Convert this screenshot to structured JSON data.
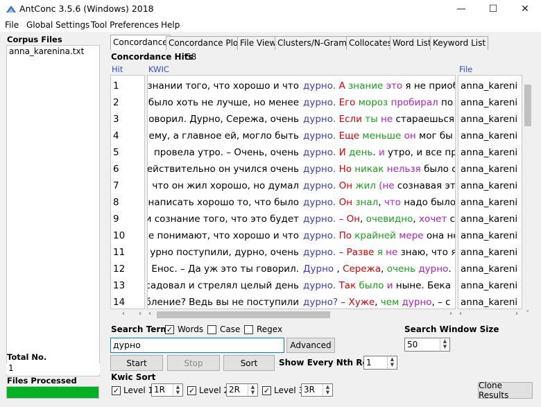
{
  "window": {
    "title": "AntConc 3.5.6 (Windows) 2018"
  },
  "menu": [
    "File",
    "Global Settings",
    "Tool Preferences",
    "Help"
  ],
  "sidebar": {
    "corpus_files_label": "Corpus Files",
    "files": [
      "anna_karenina.txt"
    ],
    "total_no_label": "Total No.",
    "total_no_value": "1",
    "files_processed_label": "Files Processed",
    "progress": 1.0
  },
  "tabs": [
    "Concordance",
    "Concordance Plot",
    "File View",
    "Clusters/N-Grams",
    "Collocates",
    "Word List",
    "Keyword List"
  ],
  "concordance": {
    "hits_label": "Concordance Hits",
    "hits_value": "58",
    "col_hit": "Hit",
    "col_kwic": "KWIC",
    "col_file": "File",
    "rows": [
      {
        "hit": "1",
        "left": "знании того, что хорошо и что",
        "kw": "дурно.",
        "right": [
          [
            "А",
            "red"
          ],
          [
            " знание ",
            "green"
          ],
          [
            "это",
            "pur"
          ],
          [
            " я не приоб",
            "black"
          ]
        ],
        "file": "anna_kareni"
      },
      {
        "hit": "2",
        "left": "было хоть не лучше, но менее",
        "kw": "дурно.",
        "right": [
          [
            "Его ",
            "red"
          ],
          [
            "мороз ",
            "green"
          ],
          [
            "пробирал",
            "pur"
          ],
          [
            " по",
            "black"
          ]
        ],
        "file": "anna_kareni"
      },
      {
        "hit": "3",
        "left": "оворил. Дурно, Сережа, очень",
        "kw": "дурно.",
        "right": [
          [
            "Если ",
            "red"
          ],
          [
            "ты ",
            "green"
          ],
          [
            "не ",
            "pur"
          ],
          [
            "стараешься у",
            "black"
          ]
        ],
        "file": "anna_kareni"
      },
      {
        "hit": "4",
        "left": "ему, а главное ей, могло быть",
        "kw": "дурно.",
        "right": [
          [
            "Еще ",
            "red"
          ],
          [
            "меньше ",
            "green"
          ],
          [
            "он",
            "pur"
          ],
          [
            " мог бы",
            "black"
          ]
        ],
        "file": "anna_kareni"
      },
      {
        "hit": "5",
        "left": "провела утро.  – Очень, очень",
        "kw": "дурно.",
        "right": [
          [
            "И ",
            "red"
          ],
          [
            "день",
            "green"
          ],
          [
            ". ",
            "black"
          ],
          [
            "и",
            "pur"
          ],
          [
            " утро, и все пр",
            "black"
          ]
        ],
        "file": "anna_kareni"
      },
      {
        "hit": "6",
        "left": "ействительно он учился очень",
        "kw": "дурно.",
        "right": [
          [
            "Но ",
            "red"
          ],
          [
            "никак ",
            "green"
          ],
          [
            "нельзя",
            "pur"
          ],
          [
            " было с",
            "black"
          ]
        ],
        "file": "anna_kareni"
      },
      {
        "hit": "7",
        "left": "что он жил хорошо, но думал",
        "kw": "дурно.",
        "right": [
          [
            " Он ",
            "red"
          ],
          [
            "жил ",
            "green"
          ],
          [
            "(не",
            "pur"
          ],
          [
            " сознавая эт",
            "black"
          ]
        ],
        "file": "anna_kareni"
      },
      {
        "hit": "8",
        "left": "написать хорошо то, что было",
        "kw": "дурно.",
        "right": [
          [
            "Он ",
            "red"
          ],
          [
            "знал",
            "green"
          ],
          [
            ", ",
            "black"
          ],
          [
            "что",
            "pur"
          ],
          [
            " надо было",
            "black"
          ]
        ],
        "file": "anna_kareni"
      },
      {
        "hit": "9",
        "left": "и сознание того, что это будет",
        "kw": "дурно.",
        "right": [
          [
            " – Он",
            "red"
          ],
          [
            ", ",
            "black"
          ],
          [
            "очевидно",
            "green"
          ],
          [
            ", ",
            "black"
          ],
          [
            "хочет",
            "pur"
          ],
          [
            " с",
            "black"
          ]
        ],
        "file": "anna_kareni"
      },
      {
        "hit": "10",
        "left": "е понимают, что хорошо и что",
        "kw": "дурно.",
        "right": [
          [
            "По ",
            "red"
          ],
          [
            "крайней ",
            "green"
          ],
          [
            "мере",
            "pur"
          ],
          [
            " она не",
            "black"
          ]
        ],
        "file": "anna_kareni"
      },
      {
        "hit": "11",
        "left": "урно поступили, дурно, очень",
        "kw": "дурно.",
        "right": [
          [
            " – Разве ",
            "red"
          ],
          [
            "я ",
            "green"
          ],
          [
            "не",
            "pur"
          ],
          [
            " знаю, что я",
            "black"
          ]
        ],
        "file": "anna_kareni"
      },
      {
        "hit": "12",
        "left": "Енос.  – Да уж это ты говорил.",
        "kw": "Дурно",
        "right": [
          [
            ", ",
            "black"
          ],
          [
            "Сережа",
            "red"
          ],
          [
            ", ",
            "black"
          ],
          [
            "очень ",
            "green"
          ],
          [
            "дурно",
            "pur"
          ],
          [
            ". Е",
            "black"
          ]
        ],
        "file": "anna_kareni"
      },
      {
        "hit": "13",
        "left": "садовал и стрелял целый день",
        "kw": "дурно.",
        "right": [
          [
            "Так ",
            "red"
          ],
          [
            "было ",
            "green"
          ],
          [
            "и",
            "pur"
          ],
          [
            " ныне. Бека",
            "black"
          ]
        ],
        "file": "anna_kareni"
      },
      {
        "hit": "14",
        "left": "бление? Ведь вы не поступили",
        "kw": "дурно?",
        "right": [
          [
            " – Хуже",
            "red"
          ],
          [
            ", ",
            "black"
          ],
          [
            "чем ",
            "green"
          ],
          [
            "дурно",
            "pur"
          ],
          [
            ", – с",
            "black"
          ]
        ],
        "file": "anna_kareni"
      }
    ]
  },
  "controls": {
    "search_term_label": "Search Term",
    "words_label": "Words",
    "case_label": "Case",
    "regex_label": "Regex",
    "search_value": "дурно",
    "advanced_label": "Advanced",
    "search_window_label": "Search Window Size",
    "search_window_value": "50",
    "start_label": "Start",
    "stop_label": "Stop",
    "sort_label": "Sort",
    "nth_row_label": "Show Every Nth Row",
    "nth_row_value": "1",
    "kwic_sort_label": "Kwic Sort",
    "level1_label": "Level 1",
    "level1_value": "1R",
    "level2_label": "Level 2",
    "level2_value": "2R",
    "level3_label": "Level 3",
    "level3_value": "3R",
    "clone_label": "Clone Results"
  },
  "colors": {
    "keyword": "#3a3ad8",
    "red": "#e00000",
    "green": "#16a316",
    "purple": "#b020c8",
    "progress": "#06b025"
  }
}
